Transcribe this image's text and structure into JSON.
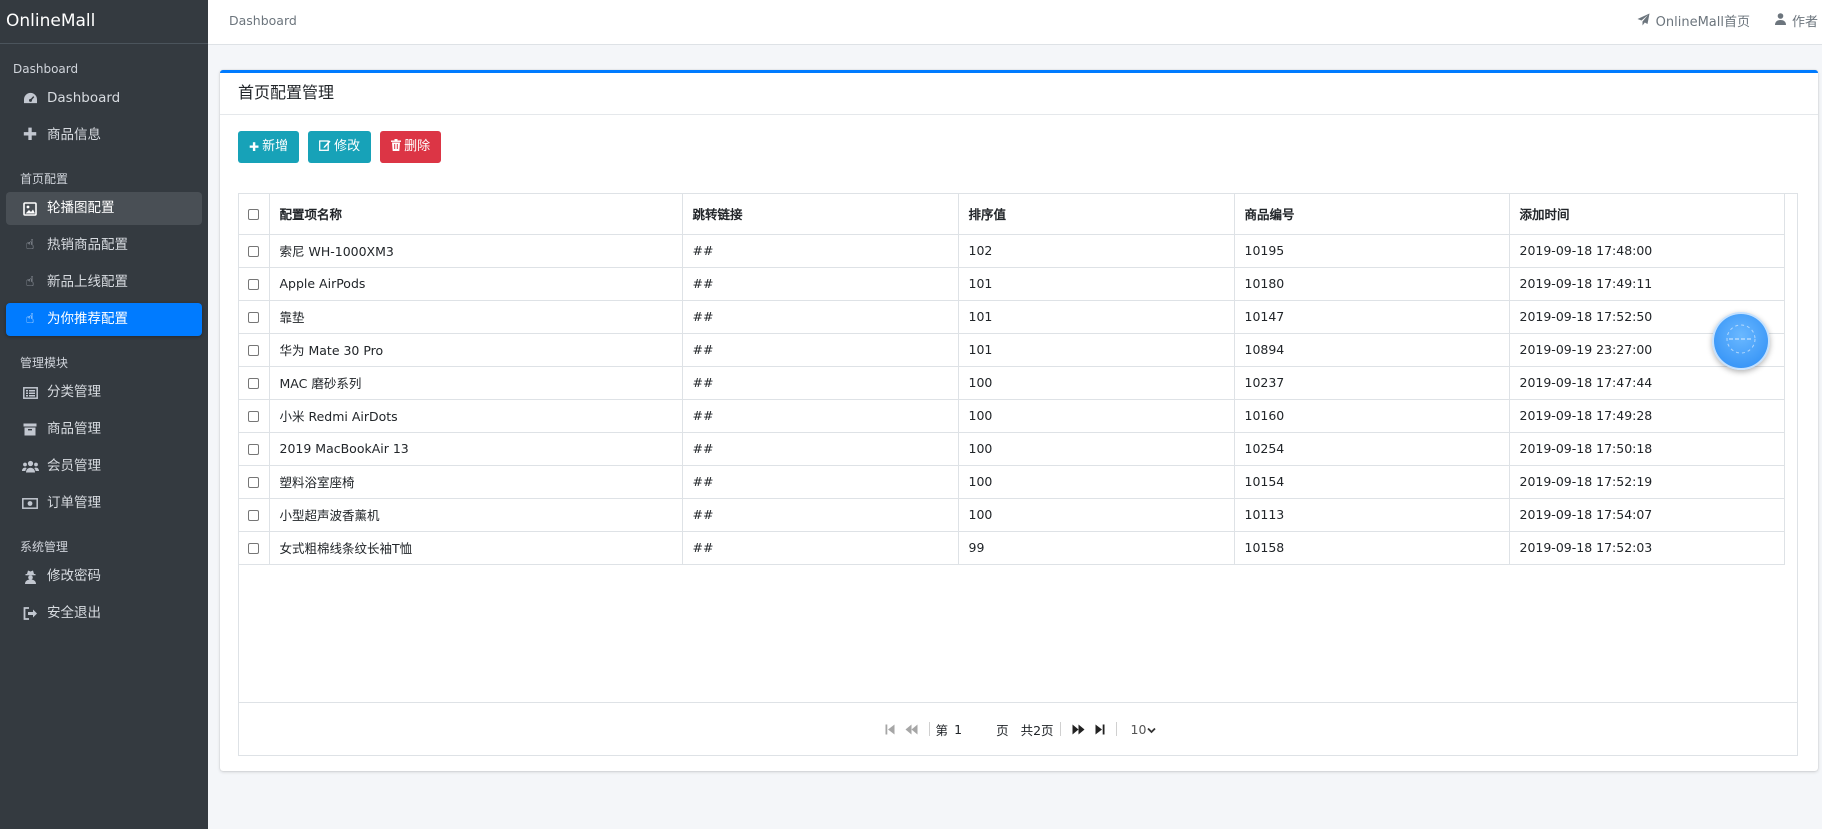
{
  "brand": "OnlineMall",
  "sidebar": {
    "sections": [
      {
        "header": "Dashboard",
        "items": [
          {
            "label": "Dashboard",
            "icon": "dashboard-icon"
          },
          {
            "label": "商品信息",
            "icon": "plus-icon"
          }
        ]
      },
      {
        "header": "首页配置",
        "items": [
          {
            "label": "轮播图配置",
            "icon": "image-icon"
          },
          {
            "label": "热销商品配置",
            "icon": "hand-pointer-icon"
          },
          {
            "label": "新品上线配置",
            "icon": "hand-pointer-icon"
          },
          {
            "label": "为你推荐配置",
            "icon": "hand-pointer-icon"
          }
        ]
      },
      {
        "header": "管理模块",
        "items": [
          {
            "label": "分类管理",
            "icon": "list-icon"
          },
          {
            "label": "商品管理",
            "icon": "archive-icon"
          },
          {
            "label": "会员管理",
            "icon": "users-icon"
          },
          {
            "label": "订单管理",
            "icon": "money-icon"
          }
        ]
      },
      {
        "header": "系统管理",
        "items": [
          {
            "label": "修改密码",
            "icon": "user-secret-icon"
          },
          {
            "label": "安全退出",
            "icon": "sign-out-icon"
          }
        ]
      }
    ]
  },
  "topbar": {
    "breadcrumb": "Dashboard",
    "links": [
      {
        "label": "OnlineMall首页",
        "icon": "paper-plane-icon"
      },
      {
        "label": "作者",
        "icon": "user-icon"
      }
    ]
  },
  "card": {
    "title": "首页配置管理",
    "buttons": {
      "add": "新增",
      "edit": "修改",
      "delete": "删除"
    }
  },
  "table": {
    "headers": [
      "配置项名称",
      "跳转链接",
      "排序值",
      "商品编号",
      "添加时间"
    ],
    "rows": [
      [
        "索尼 WH-1000XM3",
        "##",
        "102",
        "10195",
        "2019-09-18 17:48:00"
      ],
      [
        "Apple AirPods",
        "##",
        "101",
        "10180",
        "2019-09-18 17:49:11"
      ],
      [
        "靠垫",
        "##",
        "101",
        "10147",
        "2019-09-18 17:52:50"
      ],
      [
        "华为 Mate 30 Pro",
        "##",
        "101",
        "10894",
        "2019-09-19 23:27:00"
      ],
      [
        "MAC 磨砂系列",
        "##",
        "100",
        "10237",
        "2019-09-18 17:47:44"
      ],
      [
        "小米 Redmi AirDots",
        "##",
        "100",
        "10160",
        "2019-09-18 17:49:28"
      ],
      [
        "2019 MacBookAir 13",
        "##",
        "100",
        "10254",
        "2019-09-18 17:50:18"
      ],
      [
        "塑料浴室座椅",
        "##",
        "100",
        "10154",
        "2019-09-18 17:52:19"
      ],
      [
        "小型超声波香薰机",
        "##",
        "100",
        "10113",
        "2019-09-18 17:54:07"
      ],
      [
        "女式粗棉线条纹长袖T恤",
        "##",
        "99",
        "10158",
        "2019-09-18 17:52:03"
      ]
    ]
  },
  "pager": {
    "page_prefix": "第",
    "page_value": "1",
    "page_suffix": "页",
    "total": "共2页",
    "page_size": "10"
  },
  "colors": {
    "sidebar_bg": "#343a40",
    "accent": "#007bff",
    "info": "#17a2b8",
    "danger": "#dc3545"
  }
}
